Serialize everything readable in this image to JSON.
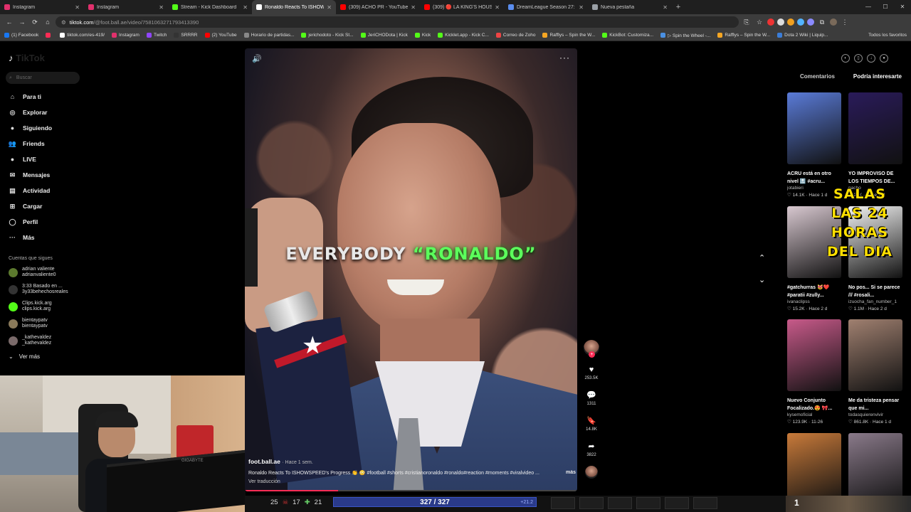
{
  "tabs": [
    {
      "label": "Instagram",
      "color": "#e1306c"
    },
    {
      "label": "Instagram",
      "color": "#e1306c"
    },
    {
      "label": "Stream - Kick Dashboard",
      "color": "#53fc18"
    },
    {
      "label": "Ronaldo Reacts To ISHOWSPE",
      "color": "#ffffff",
      "active": true
    },
    {
      "label": "(309) ACHO PR - YouTube",
      "color": "#ff0000"
    },
    {
      "label": "(309) 🔴 LA KING'S HOUSE SE",
      "color": "#ff0000"
    },
    {
      "label": "DreamLeague Season 27: Grou",
      "color": "#5a8dee"
    },
    {
      "label": "Nueva pestaña",
      "color": "#9aa0a6"
    }
  ],
  "address": {
    "host": "tiktok.com",
    "path": "/@foot.ball.ae/video/7581063271793413390"
  },
  "bookmarks": [
    {
      "label": "(1) Facebook",
      "color": "#1877f2"
    },
    {
      "label": "",
      "color": "#fe2c55"
    },
    {
      "label": "tiktok.com/es-419/",
      "color": "#ffffff"
    },
    {
      "label": "Instagram",
      "color": "#e1306c"
    },
    {
      "label": "Twitch",
      "color": "#9146ff"
    },
    {
      "label": "SRRRR",
      "color": "#333333"
    },
    {
      "label": "(2) YouTube",
      "color": "#ff0000"
    },
    {
      "label": "Horario de partidas...",
      "color": "#888888"
    },
    {
      "label": "jerichodoto - Kick St...",
      "color": "#53fc18"
    },
    {
      "label": "JeriCHODota | Kick",
      "color": "#53fc18"
    },
    {
      "label": "Kick",
      "color": "#53fc18"
    },
    {
      "label": "Kicklet.app - Kick C...",
      "color": "#53fc18"
    },
    {
      "label": "Correo de Zoho",
      "color": "#e44"
    },
    {
      "label": "Rafflys – Spin the W...",
      "color": "#f5a623"
    },
    {
      "label": "KickBot: Customiza...",
      "color": "#53fc18"
    },
    {
      "label": "▷ Spin the Wheel -...",
      "color": "#4a90e2"
    },
    {
      "label": "Rafflys – Spin the W...",
      "color": "#f5a623"
    },
    {
      "label": "Dota 2 Wiki | Liquip...",
      "color": "#3b7dd8"
    }
  ],
  "bookmarks_all": "Todos los favoritos",
  "sidebar": {
    "logo": "TikTok",
    "search_placeholder": "Buscar",
    "items": [
      {
        "label": "Para ti",
        "icon": "⌂"
      },
      {
        "label": "Explorar",
        "icon": "◎"
      },
      {
        "label": "Siguiendo",
        "icon": "●"
      },
      {
        "label": "Friends",
        "icon": "👥"
      },
      {
        "label": "LIVE",
        "icon": "●"
      },
      {
        "label": "Mensajes",
        "icon": "✉"
      },
      {
        "label": "Actividad",
        "icon": "▤"
      },
      {
        "label": "Cargar",
        "icon": "⊞"
      },
      {
        "label": "Perfil",
        "icon": "◯"
      },
      {
        "label": "Más",
        "icon": "···"
      }
    ],
    "following_header": "Cuentas que sigues",
    "following": [
      {
        "name": "adrian valiente",
        "user": "adrianvaliente0",
        "color": "#5c7a2e"
      },
      {
        "name": "3:33 Basado en ...",
        "user": "3y33behechosreales",
        "color": "#333333"
      },
      {
        "name": "Clips.kick.arg",
        "user": "clips.kick.arg",
        "color": "#53fc18"
      },
      {
        "name": "bientaypatv",
        "user": "bientaypatv",
        "color": "#8a7a5a"
      },
      {
        "name": "_kathevaldez",
        "user": "_kathevaldez",
        "color": "#7a6a6a"
      }
    ],
    "see_more": "Ver más"
  },
  "video": {
    "caption_plain": "EVERYBODY ",
    "caption_highlight": "“RONALDO”",
    "author": "foot.ball.ae",
    "posted": "· Hace 1 sem.",
    "description": "Ronaldo Reacts To ISHOWSPEED's Progress 👏 😳 #football #shorts #cristianoronaldo #ronaldo#reaction #moments #viralvideo ...",
    "more": "más",
    "translate": "Ver traducción",
    "progress_fraction": 0.28
  },
  "actions": [
    {
      "name": "like",
      "icon": "♥",
      "count": "253.5K"
    },
    {
      "name": "comment",
      "icon": "💬",
      "count": "1311"
    },
    {
      "name": "save",
      "icon": "🔖",
      "count": "14.8K"
    },
    {
      "name": "share",
      "icon": "➦",
      "count": "3822"
    }
  ],
  "panel": {
    "tab_comments": "Comentarios",
    "tab_suggested": "Podría interesarte",
    "overlay_text": "SALAS LAS 24 HORAS DEL DIA",
    "cards": [
      {
        "title": "ACRU está en otro nivel 🔝 #acru...",
        "user": "jotabieri",
        "meta": "♡ 14.1K · Hace 1 d",
        "bg": "#5a7bd8"
      },
      {
        "title": "YO IMPROVISO DE LOS TIEMPOS DE...",
        "user": "nacho",
        "meta": "♡ 20K · Hace 1 d",
        "bg": "#2a1b5a"
      },
      {
        "title": "#gatchurras 😻❤️ #paratii #zully...",
        "user": "ivanaclipss",
        "meta": "♡ 15.2K · Hace 2 d",
        "bg": "#d8c8d0"
      },
      {
        "title": "No pos... Si se parece /// #rosali...",
        "user": "izuocha_fan_number_1",
        "meta": "♡ 1.1M · Hace 2 d",
        "bg": "#f2f2f2"
      },
      {
        "title": "Nuevo Conjunto Focalizado.😍 🎀...",
        "user": "kysemoficial",
        "meta": "♡ 123.9K · 11-26",
        "bg": "#c85a8a"
      },
      {
        "title": "Me da tristeza pensar que mi...",
        "user": "todasquierenvivir",
        "meta": "♡ 861.8K · Hace 1 d",
        "bg": "#a08070"
      },
      {
        "title": "",
        "user": "",
        "meta": "",
        "bg": "#c87a3a"
      },
      {
        "title": "",
        "user": "",
        "meta": "",
        "bg": "#8a7a8a"
      }
    ]
  },
  "hud": {
    "kills": "25",
    "deaths": "17",
    "assists": "21",
    "health": "327 / 327",
    "regen": "+21.2",
    "level": "1"
  },
  "webcam_brand": "GIGABYTE"
}
